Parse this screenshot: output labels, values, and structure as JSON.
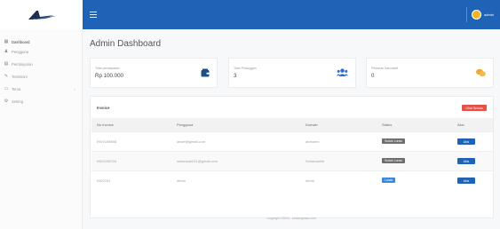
{
  "brand": {
    "logo": "winged-logo"
  },
  "topbar": {
    "user_name": "admin"
  },
  "sidebar": {
    "items": [
      {
        "label": "Dashboard",
        "icon": "dashboard-icon"
      },
      {
        "label": "Pengguna",
        "icon": "user-icon"
      },
      {
        "label": "Pembayaran",
        "icon": "payment-icon"
      },
      {
        "label": "Testimoni",
        "icon": "comment-icon"
      },
      {
        "label": "Tema",
        "icon": "theme-icon"
      },
      {
        "label": "Setting",
        "icon": "gear-icon"
      }
    ]
  },
  "main": {
    "title": "Admin Dashboard",
    "cards": [
      {
        "label": "Total pendapatan",
        "value": "Rp 100.000",
        "icon": "wallet-icon",
        "color": "#1e4f86"
      },
      {
        "label": "Total Pelanggan",
        "value": "3",
        "icon": "users-icon",
        "color": "#2b6cc8"
      },
      {
        "label": "Pesanan baru/aktif",
        "value": "0",
        "icon": "chat-icon",
        "color": "#f0a830"
      }
    ]
  },
  "invoice": {
    "title": "Invoice",
    "button": "Lihat Semua",
    "headers": [
      "No Invoice",
      "Pengguna",
      "Domain",
      "Status",
      "Aksi"
    ],
    "rows": [
      {
        "no": "INV0158698",
        "user": "abizfr@gmail.com",
        "domain": "abelarmi",
        "status": "Sudah Lunas",
        "status_type": "done",
        "action": "Aksi"
      },
      {
        "no": "INV0158703",
        "user": "sultanuari011@gmail.com",
        "domain": "Sultanzarhe",
        "status": "Sudah Lunas",
        "status_type": "done",
        "action": "Aksi"
      },
      {
        "no": "INV0151",
        "user": "demo",
        "domain": "demo",
        "status": "Lunas",
        "status_type": "new",
        "action": "Aksi"
      }
    ]
  },
  "footer": {
    "text": "Copyright ©2024 · Undanganku.com"
  },
  "colors": {
    "primary": "#1e63b6",
    "danger": "#e55147",
    "muted": "#6e6e6e"
  }
}
